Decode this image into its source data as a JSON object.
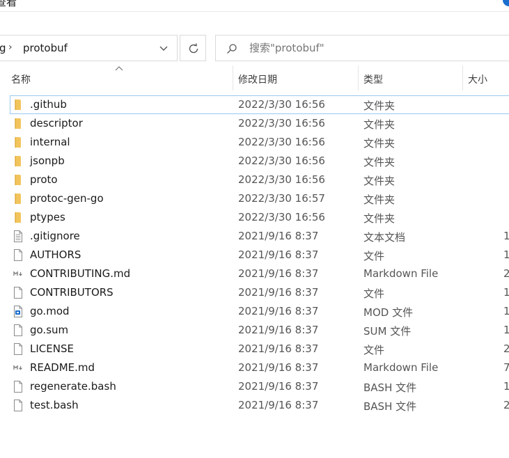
{
  "window": {
    "title_fragment": "查看"
  },
  "address_bar": {
    "previous_segment": "g",
    "current_folder": "protobuf"
  },
  "search": {
    "placeholder": "搜索\"protobuf\""
  },
  "columns": {
    "name": "名称",
    "date": "修改日期",
    "type": "类型",
    "size": "大小"
  },
  "sort": {
    "column": "name",
    "direction": "ascending"
  },
  "colors": {
    "folder": "#f2c55c",
    "accent": "#1a6fce",
    "focus_border": "#99c9ef"
  },
  "files": [
    {
      "name": ".github",
      "date": "2022/3/30 16:56",
      "type": "文件夹",
      "size": "",
      "icon": "folder-icon",
      "focused": true
    },
    {
      "name": "descriptor",
      "date": "2022/3/30 16:56",
      "type": "文件夹",
      "size": "",
      "icon": "folder-icon"
    },
    {
      "name": "internal",
      "date": "2022/3/30 16:56",
      "type": "文件夹",
      "size": "",
      "icon": "folder-icon"
    },
    {
      "name": "jsonpb",
      "date": "2022/3/30 16:56",
      "type": "文件夹",
      "size": "",
      "icon": "folder-icon"
    },
    {
      "name": "proto",
      "date": "2022/3/30 16:56",
      "type": "文件夹",
      "size": "",
      "icon": "folder-icon"
    },
    {
      "name": "protoc-gen-go",
      "date": "2022/3/30 16:57",
      "type": "文件夹",
      "size": "",
      "icon": "folder-icon"
    },
    {
      "name": "ptypes",
      "date": "2022/3/30 16:56",
      "type": "文件夹",
      "size": "",
      "icon": "folder-icon"
    },
    {
      "name": ".gitignore",
      "date": "2021/9/16 8:37",
      "type": "文本文档",
      "size": "1",
      "icon": "text-file-icon"
    },
    {
      "name": "AUTHORS",
      "date": "2021/9/16 8:37",
      "type": "文件",
      "size": "1",
      "icon": "file-icon"
    },
    {
      "name": "CONTRIBUTING.md",
      "date": "2021/9/16 8:37",
      "type": "Markdown File",
      "size": "2",
      "icon": "markdown-file-icon"
    },
    {
      "name": "CONTRIBUTORS",
      "date": "2021/9/16 8:37",
      "type": "文件",
      "size": "1",
      "icon": "file-icon"
    },
    {
      "name": "go.mod",
      "date": "2021/9/16 8:37",
      "type": "MOD 文件",
      "size": "1",
      "icon": "mod-file-icon"
    },
    {
      "name": "go.sum",
      "date": "2021/9/16 8:37",
      "type": "SUM 文件",
      "size": "1",
      "icon": "file-icon"
    },
    {
      "name": "LICENSE",
      "date": "2021/9/16 8:37",
      "type": "文件",
      "size": "2",
      "icon": "file-icon"
    },
    {
      "name": "README.md",
      "date": "2021/9/16 8:37",
      "type": "Markdown File",
      "size": "7",
      "icon": "markdown-file-icon"
    },
    {
      "name": "regenerate.bash",
      "date": "2021/9/16 8:37",
      "type": "BASH 文件",
      "size": "1",
      "icon": "file-icon"
    },
    {
      "name": "test.bash",
      "date": "2021/9/16 8:37",
      "type": "BASH 文件",
      "size": "2",
      "icon": "file-icon"
    }
  ]
}
